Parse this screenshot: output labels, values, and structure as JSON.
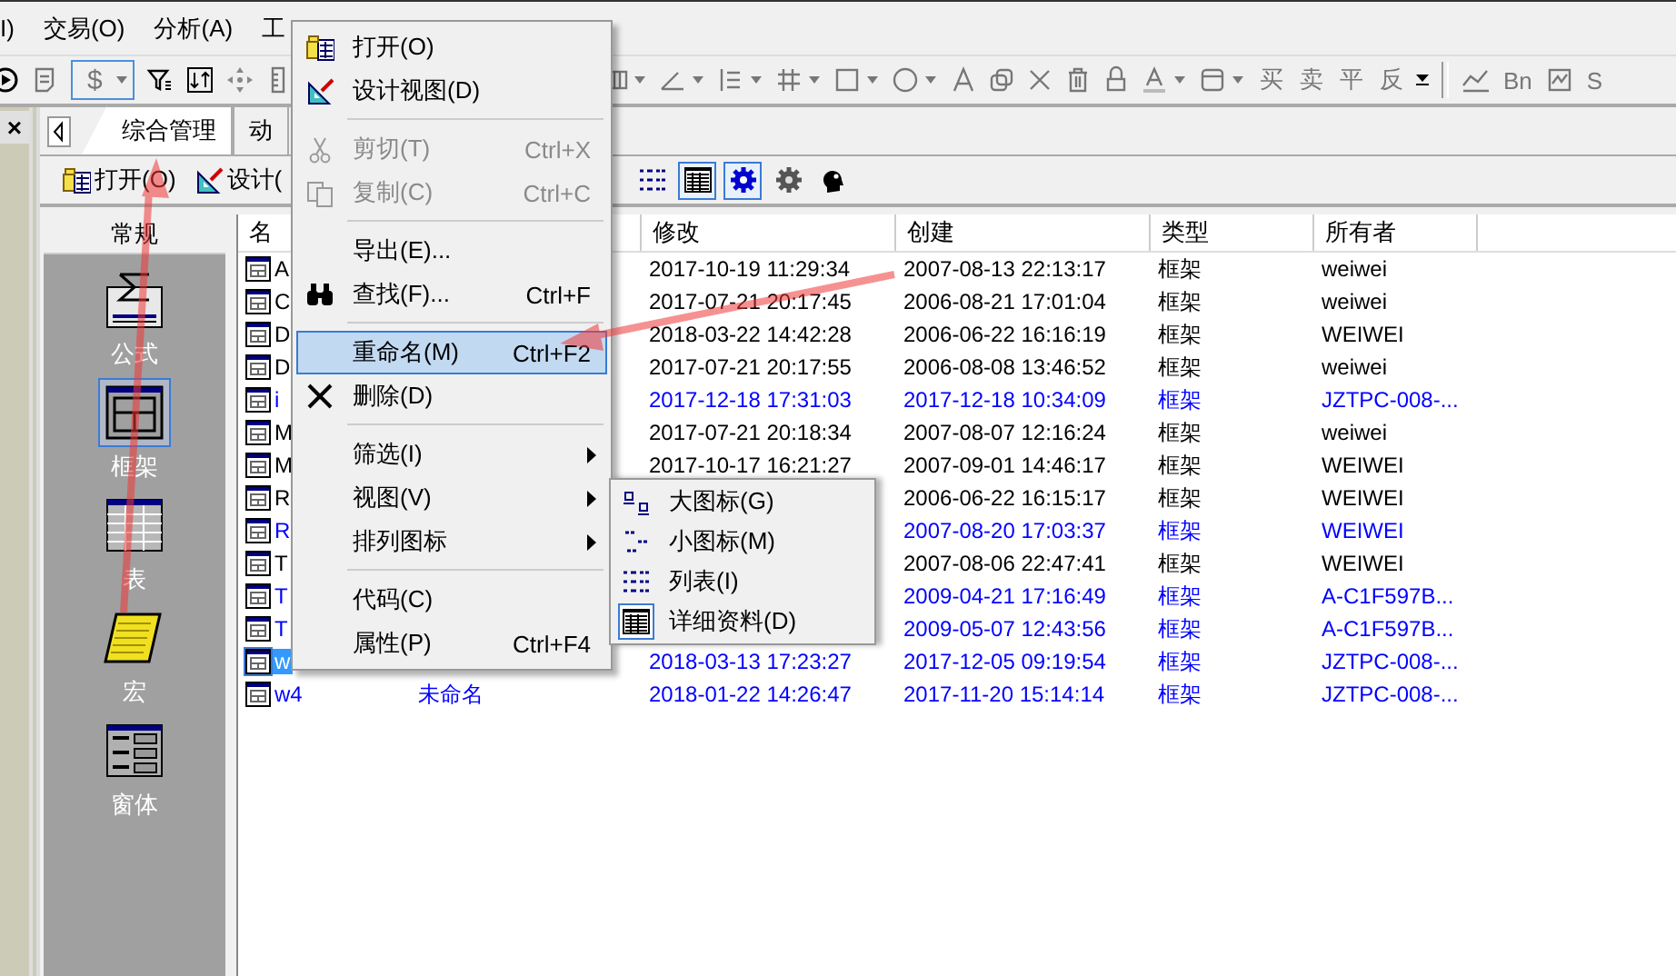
{
  "menu_bar": [
    "I)",
    "交易(O)",
    "分析(A)",
    "工"
  ],
  "toolbar": {
    "currency_field": {
      "value": "$"
    },
    "trade_labels": [
      "买",
      "卖",
      "平",
      "反"
    ],
    "chart_labels": [
      "Bn",
      "S"
    ]
  },
  "side_strip": {
    "close": "×"
  },
  "tabs": [
    {
      "label": "综合管理",
      "selected": true
    },
    {
      "label": "动",
      "selected": false
    }
  ],
  "tab_toolbar": {
    "buttons": [
      {
        "label": "打开(O)"
      },
      {
        "label": "设计("
      }
    ],
    "view_buttons": [
      {
        "kind": "list",
        "selected": false
      },
      {
        "kind": "details",
        "selected": true
      },
      {
        "kind": "gear-blue",
        "selected": true
      },
      {
        "kind": "gear",
        "selected": false
      },
      {
        "kind": "head",
        "selected": false
      }
    ]
  },
  "nav": {
    "header": "常规",
    "items": [
      {
        "label": "公式",
        "kind": "formula",
        "selected": false
      },
      {
        "label": "框架",
        "kind": "frame",
        "selected": true
      },
      {
        "label": "表",
        "kind": "table",
        "selected": false
      },
      {
        "label": "宏",
        "kind": "macro",
        "selected": false
      },
      {
        "label": "窗体",
        "kind": "form",
        "selected": false
      }
    ]
  },
  "table": {
    "columns": [
      "名",
      "修改",
      "创建",
      "类型",
      "所有者"
    ],
    "rows": [
      {
        "name": "A",
        "created": "2007-08-13 22:13:17",
        "modified": "2017-10-19 11:29:34",
        "type": "框架",
        "owner": "weiwei",
        "color": "#000000",
        "selected": false
      },
      {
        "name": "C",
        "created": "2006-08-21 17:01:04",
        "modified": "2017-07-21 20:17:45",
        "type": "框架",
        "owner": "weiwei",
        "color": "#000000",
        "selected": false
      },
      {
        "name": "D",
        "created": "2006-06-22 16:16:19",
        "modified": "2018-03-22 14:42:28",
        "type": "框架",
        "owner": "WEIWEI",
        "color": "#000000",
        "selected": false
      },
      {
        "name": "D",
        "created": "2006-08-08 13:46:52",
        "modified": "2017-07-21 20:17:55",
        "type": "框架",
        "owner": "weiwei",
        "color": "#000000",
        "selected": false
      },
      {
        "name": "i",
        "created": "2017-12-18 10:34:09",
        "modified": "2017-12-18 17:31:03",
        "type": "框架",
        "owner": "JZTPC-008-...",
        "color": "#0000ff",
        "selected": false
      },
      {
        "name": "M",
        "created": "2007-08-07 12:16:24",
        "modified": "2017-07-21 20:18:34",
        "type": "框架",
        "owner": "weiwei",
        "color": "#000000",
        "selected": false
      },
      {
        "name": "M",
        "created": "2007-09-01 14:46:17",
        "modified": "2017-10-17 16:21:27",
        "type": "框架",
        "owner": "WEIWEI",
        "color": "#000000",
        "selected": false
      },
      {
        "name": "R",
        "created": "2006-06-22 16:15:17",
        "type": "框架",
        "owner": "WEIWEI",
        "color": "#000000",
        "selected": false
      },
      {
        "name": "R",
        "created": "2007-08-20 17:03:37",
        "type": "框架",
        "owner": "WEIWEI",
        "color": "#0000ff",
        "selected": false
      },
      {
        "name": "T",
        "created": "2007-08-06 22:47:41",
        "type": "框架",
        "owner": "WEIWEI",
        "color": "#000000",
        "selected": false
      },
      {
        "name": "T",
        "created": "2009-04-21 17:16:49",
        "type": "框架",
        "owner": "A-C1F597B...",
        "color": "#0000ff",
        "selected": false
      },
      {
        "name": "T",
        "created": "2009-05-07 12:43:56",
        "type": "框架",
        "owner": "A-C1F597B...",
        "color": "#0000ff",
        "selected": false
      },
      {
        "name": "w",
        "created": "2017-12-05 09:19:54",
        "modified": "2018-03-13 17:23:27",
        "type": "框架",
        "owner": "JZTPC-008-...",
        "color": "#0000ff",
        "selected": true
      },
      {
        "name": "w4",
        "column_2": "未命名",
        "created": "2017-11-20 15:14:14",
        "modified": "2018-01-22 14:26:47",
        "type": "框架",
        "owner": "JZTPC-008-...",
        "color": "#0000ff",
        "selected": false
      }
    ]
  },
  "context_menu": {
    "items": [
      {
        "kind": "item",
        "label": "打开(O)",
        "disabled": false,
        "selected": false,
        "submenu": false
      },
      {
        "kind": "item",
        "label": "设计视图(D)",
        "disabled": false,
        "selected": false,
        "submenu": false
      },
      {
        "kind": "separator"
      },
      {
        "kind": "item",
        "label": "剪切(T)",
        "shortcut": "Ctrl+X",
        "disabled": true,
        "selected": false,
        "submenu": false
      },
      {
        "kind": "item",
        "label": "复制(C)",
        "shortcut": "Ctrl+C",
        "disabled": true,
        "selected": false,
        "submenu": false
      },
      {
        "kind": "separator"
      },
      {
        "kind": "item",
        "label": "导出(E)...",
        "disabled": false,
        "selected": false,
        "submenu": false
      },
      {
        "kind": "item",
        "label": "查找(F)...",
        "shortcut": "Ctrl+F",
        "disabled": false,
        "selected": false,
        "submenu": false
      },
      {
        "kind": "separator"
      },
      {
        "kind": "item",
        "label": "重命名(M)",
        "shortcut": "Ctrl+F2",
        "disabled": false,
        "selected": true,
        "submenu": false
      },
      {
        "kind": "item",
        "label": "删除(D)",
        "disabled": false,
        "selected": false,
        "submenu": false
      },
      {
        "kind": "separator"
      },
      {
        "kind": "item",
        "label": "筛选(I)",
        "disabled": false,
        "selected": false,
        "submenu": true
      },
      {
        "kind": "item",
        "label": "视图(V)",
        "disabled": false,
        "selected": false,
        "submenu": true
      },
      {
        "kind": "item",
        "label": "排列图标",
        "disabled": false,
        "selected": false,
        "submenu": true
      },
      {
        "kind": "separator"
      },
      {
        "kind": "item",
        "label": "代码(C)",
        "disabled": false,
        "selected": false,
        "submenu": false
      },
      {
        "kind": "item",
        "label": "属性(P)",
        "shortcut": "Ctrl+F4",
        "disabled": false,
        "selected": false,
        "submenu": false
      }
    ]
  },
  "view_submenu": {
    "items": [
      {
        "label": "大图标(G)",
        "selected": false
      },
      {
        "label": "小图标(M)",
        "selected": false
      },
      {
        "label": "列表(I)",
        "selected": false
      },
      {
        "label": "详细资料(D)",
        "selected": true
      }
    ]
  }
}
